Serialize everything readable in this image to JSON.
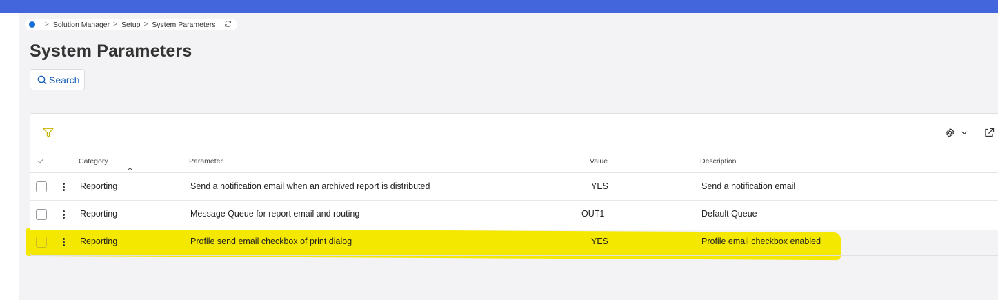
{
  "breadcrumb": {
    "items": [
      "Solution Manager",
      "Setup",
      "System Parameters"
    ]
  },
  "page": {
    "title": "System Parameters",
    "search_label": "Search"
  },
  "table": {
    "columns": {
      "category": "Category",
      "parameter": "Parameter",
      "value": "Value",
      "description": "Description"
    },
    "rows": [
      {
        "category": "Reporting",
        "parameter": "Send a notification email when an archived report is distributed",
        "value": "YES",
        "description": "Send a notification email"
      },
      {
        "category": "Reporting",
        "parameter": "Message Queue for report email and routing",
        "value": "OUT1",
        "description": "Default Queue"
      },
      {
        "category": "Reporting",
        "parameter": "Profile send email checkbox of print dialog",
        "value": "YES",
        "description": "Profile email checkbox enabled"
      }
    ]
  },
  "colors": {
    "topbar": "#4466dd",
    "link": "#1a5fb4",
    "filter": "#c9b300",
    "highlight": "#f5e800"
  }
}
